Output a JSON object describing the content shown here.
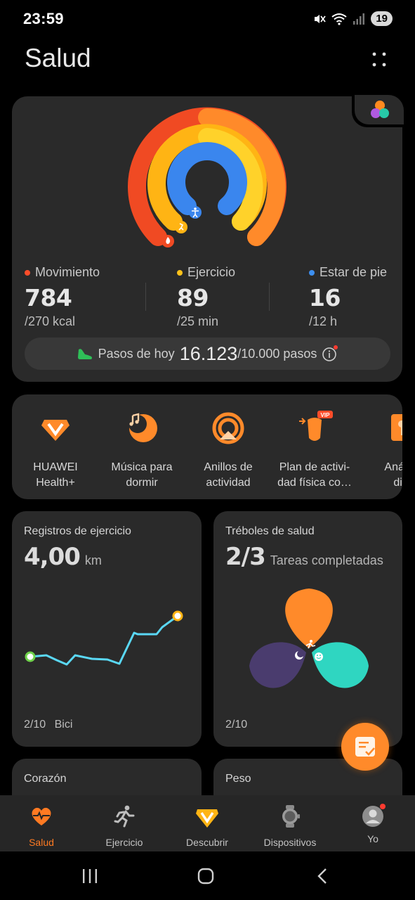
{
  "status_bar": {
    "time": "23:59",
    "battery": "19",
    "icons": [
      "mute-icon",
      "wifi-icon",
      "signal-icon"
    ]
  },
  "header": {
    "title": "Salud"
  },
  "activity": {
    "metrics": [
      {
        "label": "Movimiento",
        "value": "784",
        "goal": "/270 kcal",
        "color": "#ff4d2a",
        "progress": 2.9
      },
      {
        "label": "Ejercicio",
        "value": "89",
        "goal": "/25 min",
        "color": "#ffc21a",
        "progress": 3.56
      },
      {
        "label": "Estar de pie",
        "value": "16",
        "goal": "/12 h",
        "color": "#3d8ff0",
        "progress": 1.33
      }
    ],
    "steps": {
      "label": "Pasos de hoy",
      "value": "16.123",
      "goal": "/10.000 pasos"
    }
  },
  "shortcuts": [
    {
      "label_line1": "HUAWEI",
      "label_line2": "Health+",
      "icon": "huawei-health-plus-icon"
    },
    {
      "label_line1": "Música para",
      "label_line2": "dormir",
      "icon": "sleep-music-icon"
    },
    {
      "label_line1": "Anillos de",
      "label_line2": "actividad",
      "icon": "activity-rings-icon"
    },
    {
      "label_line1": "Plan de activi-",
      "label_line2": "dad física co…",
      "icon": "fitness-plan-icon",
      "badge": "VIP"
    },
    {
      "label_line1": "Análisi",
      "label_line2": "die",
      "icon": "diet-analysis-icon"
    }
  ],
  "tiles": {
    "exercise": {
      "title": "Registros de ejercicio",
      "value": "4,00",
      "unit": "km",
      "date": "2/10",
      "type": "Bici"
    },
    "clovers": {
      "title": "Tréboles de salud",
      "value": "2/3",
      "unit": "Tareas completadas",
      "date": "2/10"
    },
    "heart": {
      "title": "Corazón"
    },
    "weight": {
      "title": "Peso"
    }
  },
  "bottom_nav": [
    {
      "label": "Salud",
      "icon": "heart-icon",
      "active": true
    },
    {
      "label": "Ejercicio",
      "icon": "running-icon",
      "active": false
    },
    {
      "label": "Descubrir",
      "icon": "discover-icon",
      "active": false
    },
    {
      "label": "Dispositivos",
      "icon": "watch-icon",
      "active": false
    },
    {
      "label": "Yo",
      "icon": "profile-icon",
      "active": false
    }
  ],
  "colors": {
    "accent": "#ff7a22",
    "move": "#ff4d2a",
    "exercise": "#ffc21a",
    "stand": "#3d8ff0",
    "route": "#5ad8f5"
  }
}
